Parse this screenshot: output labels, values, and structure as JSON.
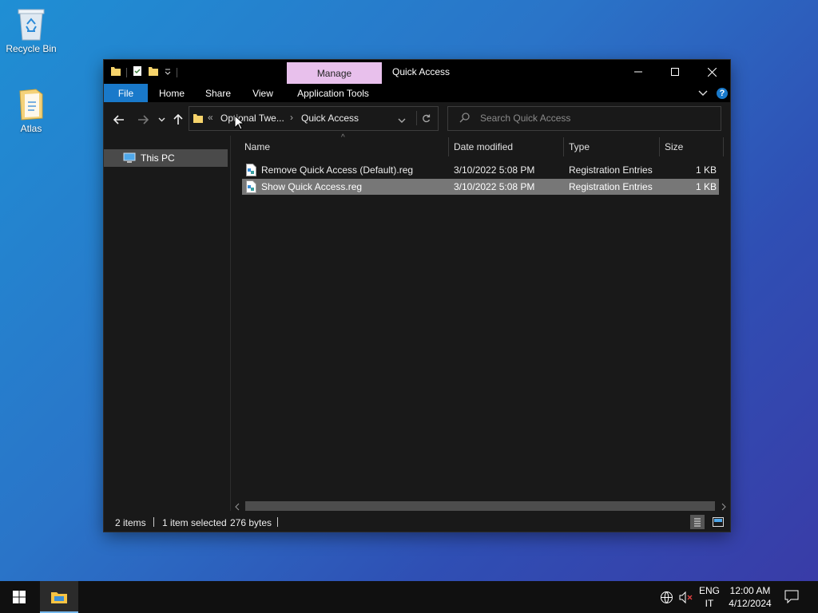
{
  "desktop": {
    "icons": [
      {
        "label": "Recycle Bin",
        "icon": "recycle-bin-icon"
      },
      {
        "label": "Atlas",
        "icon": "folder-icon"
      }
    ]
  },
  "window": {
    "title": "Quick Access",
    "contextual_tab": "Manage",
    "ribbon_tabs": [
      "File",
      "Home",
      "Share",
      "View",
      "Application Tools"
    ],
    "breadcrumb": {
      "overflow": "«",
      "parent": "Optional Twe...",
      "current": "Quick Access"
    },
    "search_placeholder": "Search Quick Access",
    "nav_pane": {
      "items": [
        {
          "label": "This PC",
          "icon": "computer-icon",
          "selected": true
        }
      ]
    },
    "columns": [
      "Name",
      "Date modified",
      "Type",
      "Size"
    ],
    "files": [
      {
        "name": "Remove Quick Access (Default).reg",
        "date": "3/10/2022 5:08 PM",
        "type": "Registration Entries",
        "size": "1 KB",
        "selected": false
      },
      {
        "name": "Show Quick Access.reg",
        "date": "3/10/2022 5:08 PM",
        "type": "Registration Entries",
        "size": "1 KB",
        "selected": true
      }
    ],
    "status": {
      "items": "2 items",
      "selected": "1 item selected",
      "bytes": "276 bytes"
    }
  },
  "taskbar": {
    "lang_top": "ENG",
    "lang_bottom": "IT",
    "time": "12:00 AM",
    "date": "4/12/2024"
  },
  "colors": {
    "accent": "#1979ca",
    "manage_tab": "#e8c0ec",
    "selection": "#777777",
    "window_bg": "#191919"
  }
}
